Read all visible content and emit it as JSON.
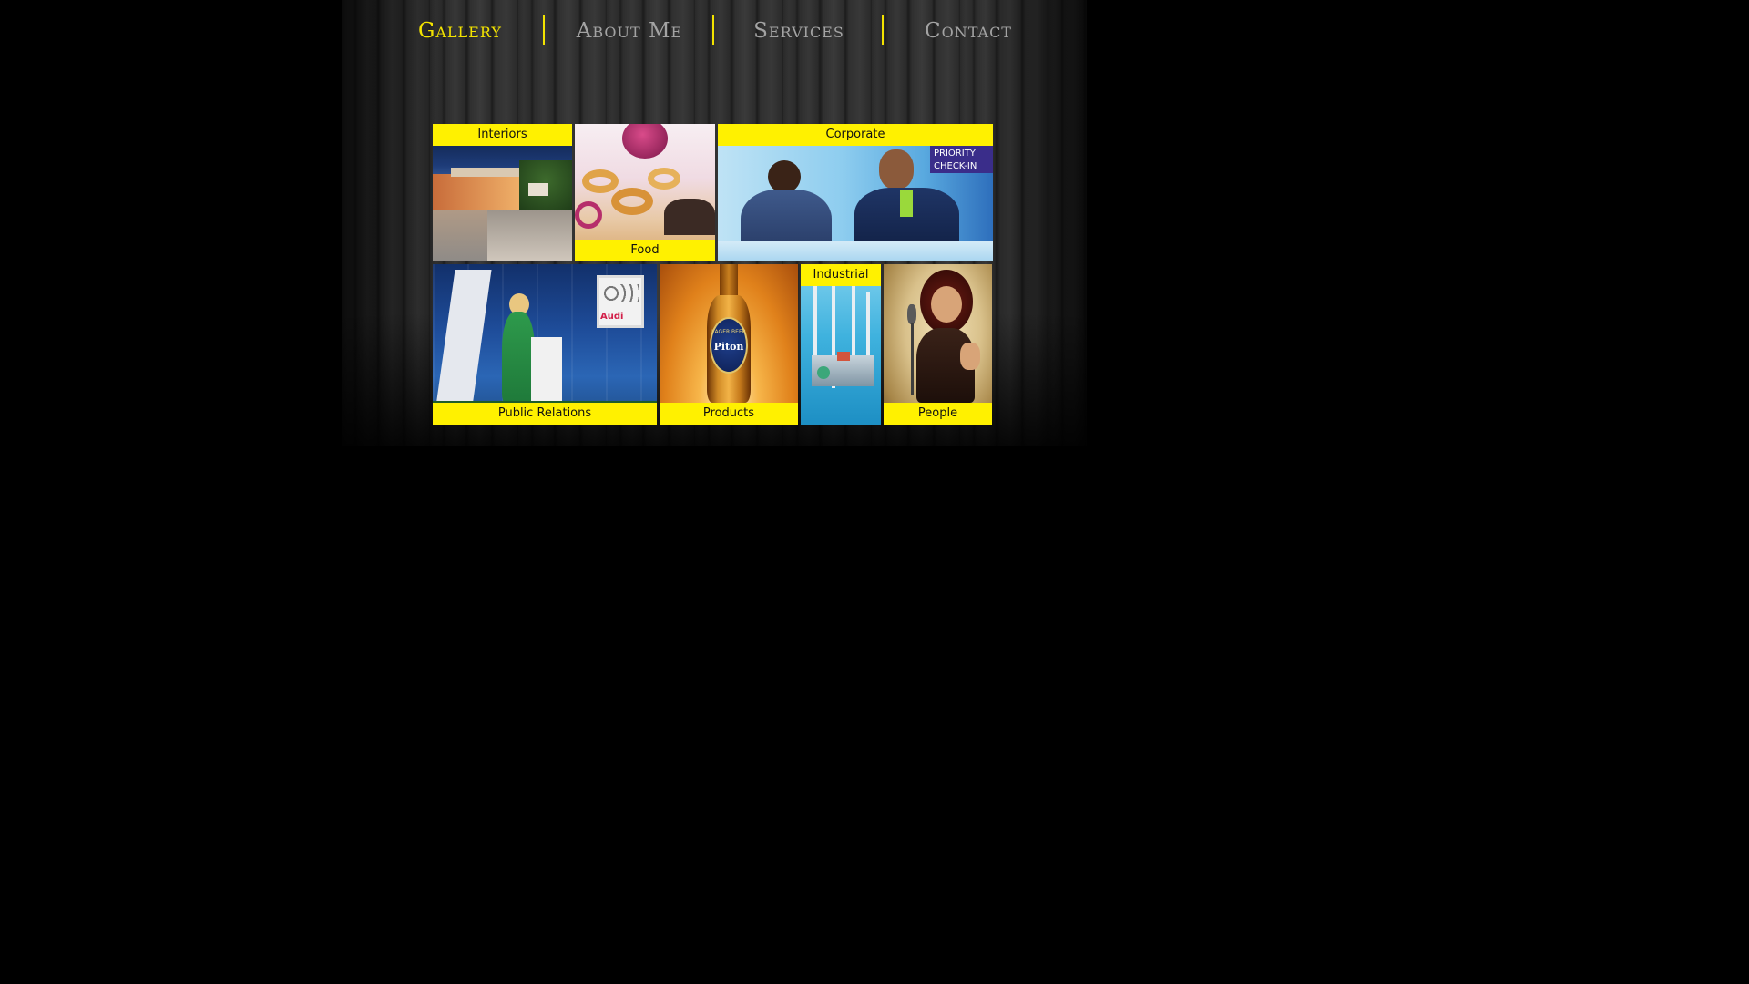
{
  "nav": {
    "items": [
      {
        "label": "Gallery",
        "active": true
      },
      {
        "label": "About Me",
        "active": false
      },
      {
        "label": "Services",
        "active": false
      },
      {
        "label": "Contact",
        "active": false
      }
    ]
  },
  "gallery": {
    "interiors": {
      "label": "Interiors"
    },
    "food": {
      "label": "Food"
    },
    "corporate": {
      "label": "Corporate",
      "sign_text": "PRIORITY CHECK-IN"
    },
    "public_relations": {
      "label": "Public Relations",
      "brand_text": "Audi"
    },
    "products": {
      "label": "Products",
      "bottle_text": "Piton",
      "bottle_subtext": "LAGER BEER"
    },
    "industrial": {
      "label": "Industrial"
    },
    "people": {
      "label": "People"
    }
  },
  "colors": {
    "accent_yellow": "#fff100",
    "nav_active": "#f3e300",
    "nav_inactive": "#a3a3a3",
    "background": "#000000"
  }
}
